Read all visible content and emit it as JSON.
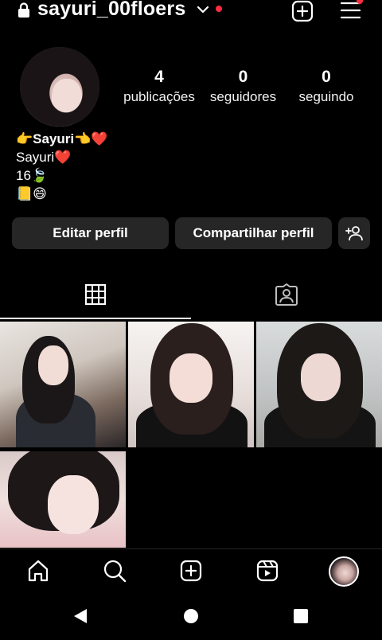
{
  "header": {
    "username": "sayuri_00floers",
    "icons": {
      "lock": "lock-icon",
      "chevron": "chevron-down-icon",
      "add": "plus-square-icon",
      "menu": "hamburger-menu-icon"
    }
  },
  "profile": {
    "stats": [
      {
        "value": "4",
        "label": "publicações"
      },
      {
        "value": "0",
        "label": "seguidores"
      },
      {
        "value": "0",
        "label": "seguindo"
      }
    ],
    "bio": {
      "name_line": "👉Sayuri👈❤️",
      "line1_text": "Sayuri",
      "line1_emoji": "❤️",
      "line2": "16🍃",
      "line3": "📒😄"
    }
  },
  "actions": {
    "edit_label": "Editar perfil",
    "share_label": "Compartilhar perfil"
  },
  "tabs": [
    {
      "name": "grid",
      "icon": "grid-icon",
      "active": true
    },
    {
      "name": "tagged",
      "icon": "tagged-person-icon",
      "active": false
    }
  ],
  "posts_count": 4,
  "bottom_nav": [
    "home-icon",
    "search-icon",
    "create-icon",
    "reels-icon",
    "profile-avatar"
  ],
  "colors": {
    "background": "#000000",
    "button": "#262626",
    "notification": "#ff2d3f",
    "heart": "#e8202a"
  }
}
